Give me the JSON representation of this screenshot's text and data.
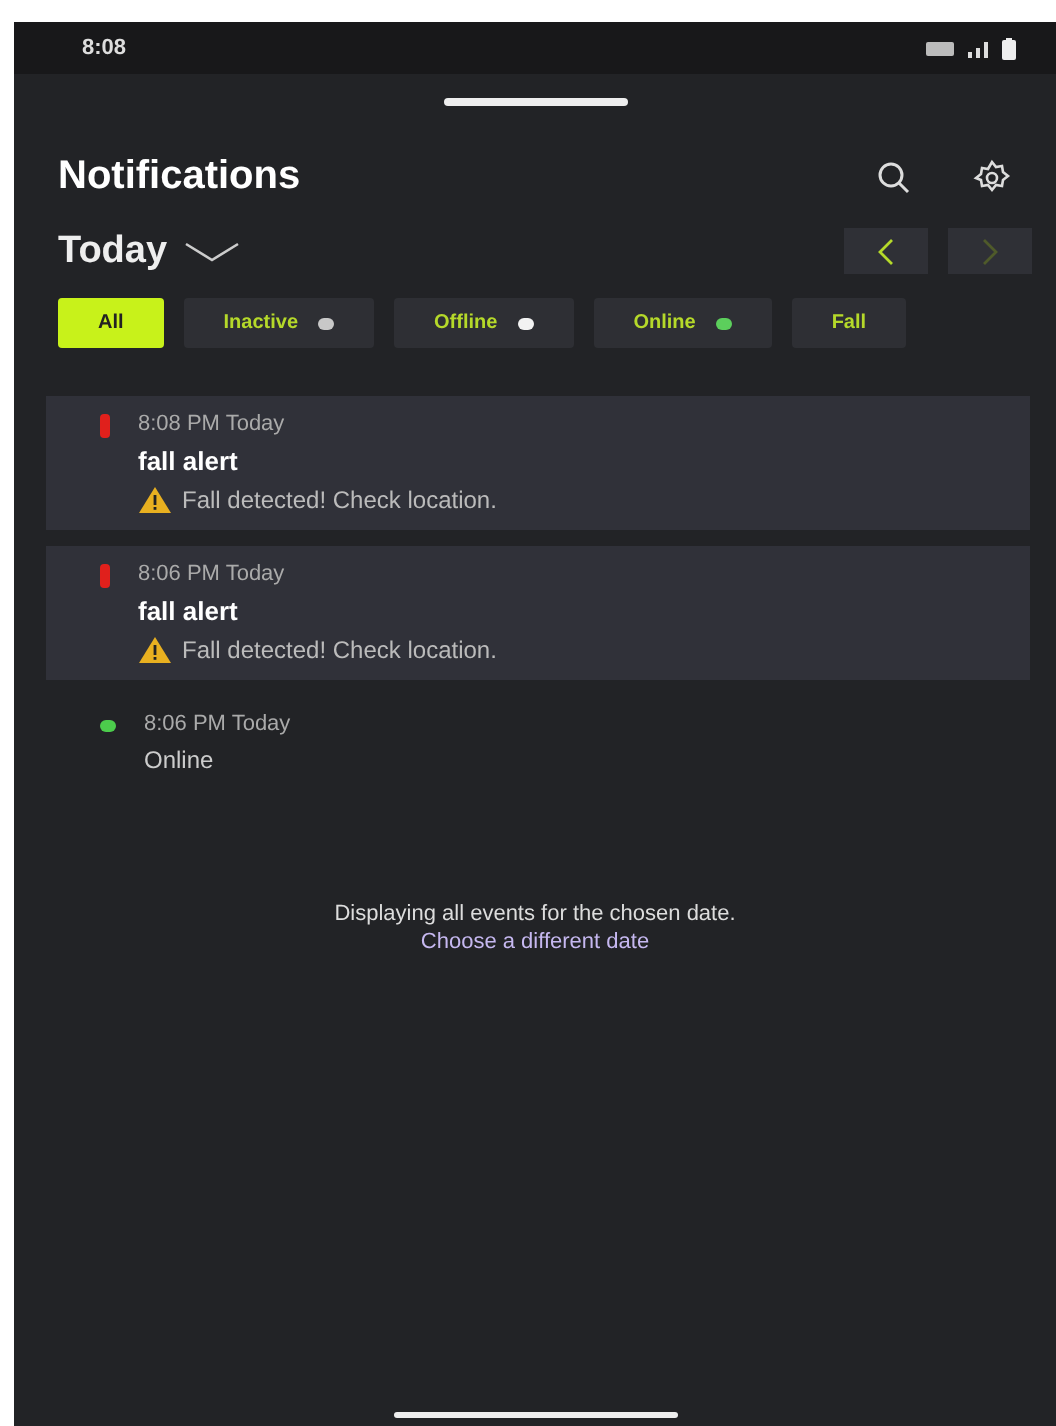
{
  "status_bar": {
    "time": "8:08"
  },
  "header": {
    "title": "Notifications"
  },
  "date_picker": {
    "label": "Today"
  },
  "filters": [
    {
      "label": "All",
      "selected": true
    },
    {
      "label": "Inactive",
      "selected": false,
      "color": "#c8c8c8"
    },
    {
      "label": "Offline",
      "selected": false,
      "color": "#f2f2f2"
    },
    {
      "label": "Online",
      "selected": false,
      "color": "#5ccf5c"
    },
    {
      "label": "Fall",
      "selected": false
    }
  ],
  "events": [
    {
      "kind": "alert",
      "color": "#e0201c",
      "time": "8:08 PM Today",
      "title": "fall alert",
      "message": "Fall detected! Check location."
    },
    {
      "kind": "alert",
      "color": "#e0201c",
      "time": "8:06 PM Today",
      "title": "fall alert",
      "message": "Fall detected! Check location."
    },
    {
      "kind": "status",
      "color": "#4ccc4c",
      "time": "8:06 PM Today",
      "title": "Online"
    }
  ],
  "footer": {
    "text": "Displaying all events for the chosen date.",
    "link": "Choose a different date"
  }
}
